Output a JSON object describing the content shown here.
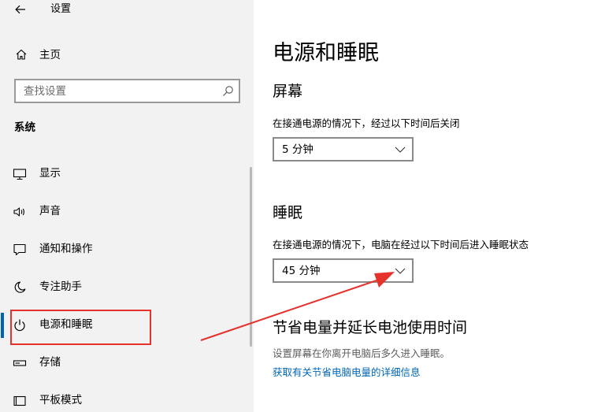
{
  "window": {
    "title": "设置",
    "back_icon": "back-arrow-icon"
  },
  "sidebar": {
    "home_label": "主页",
    "search_placeholder": "查找设置",
    "section_label": "系统",
    "items": [
      {
        "label": "显示",
        "icon": "display-icon",
        "selected": false
      },
      {
        "label": "声音",
        "icon": "sound-icon",
        "selected": false
      },
      {
        "label": "通知和操作",
        "icon": "notification-icon",
        "selected": false
      },
      {
        "label": "专注助手",
        "icon": "moon-icon",
        "selected": false
      },
      {
        "label": "电源和睡眠",
        "icon": "power-icon",
        "selected": true
      },
      {
        "label": "存储",
        "icon": "storage-icon",
        "selected": false
      },
      {
        "label": "平板模式",
        "icon": "tablet-icon",
        "selected": false
      }
    ]
  },
  "main": {
    "title": "电源和睡眠",
    "screen": {
      "heading": "屏幕",
      "description": "在接通电源的情况下，经过以下时间后关闭",
      "selected": "5 分钟"
    },
    "sleep": {
      "heading": "睡眠",
      "description": "在接通电源的情况下，电脑在经过以下时间后进入睡眠状态",
      "selected": "45 分钟"
    },
    "save_power": {
      "heading": "节省电量并延长电池使用时间",
      "description": "设置屏幕在你离开电脑后多久进入睡眠。",
      "link": "获取有关节省电脑电量的详细信息"
    }
  },
  "colors": {
    "accent": "#0063b1",
    "link": "#0066b4",
    "annotation": "#e5322d",
    "sidebar_bg": "#f2f2f2"
  }
}
